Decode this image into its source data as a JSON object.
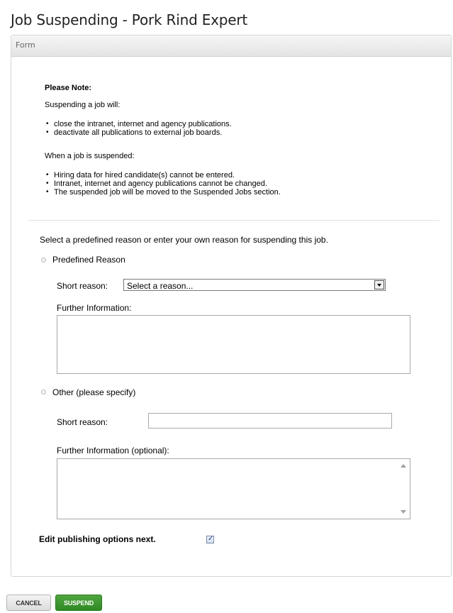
{
  "page": {
    "title": "Job Suspending - Pork Rind Expert"
  },
  "panel": {
    "header": "Form"
  },
  "note": {
    "heading": "Please Note:",
    "suspending_intro": "Suspending a job will:",
    "suspending_items": [
      "close the intranet, internet and agency publications.",
      "deactivate all publications to external job boards."
    ],
    "suspended_intro": "When a job is suspended:",
    "suspended_items": [
      "Hiring data for hired candidate(s) cannot be entered.",
      "Intranet, internet and agency publications cannot be changed.",
      "The suspended job will be moved to the Suspended Jobs section."
    ]
  },
  "form": {
    "instruction": "Select a predefined reason or enter your own reason for suspending this job.",
    "predefined": {
      "label": "Predefined Reason",
      "short_reason_label": "Short reason:",
      "short_reason_value": "Select a reason...",
      "further_info_label": "Further Information:",
      "further_info_value": ""
    },
    "other": {
      "label": "Other (please specify)",
      "short_reason_label": "Short reason:",
      "short_reason_value": "",
      "further_info_label": "Further Information (optional):",
      "further_info_value": ""
    },
    "edit_publishing": {
      "label": "Edit publishing options next.",
      "checked": true
    }
  },
  "buttons": {
    "cancel": "CANCEL",
    "suspend": "SUSPEND"
  }
}
